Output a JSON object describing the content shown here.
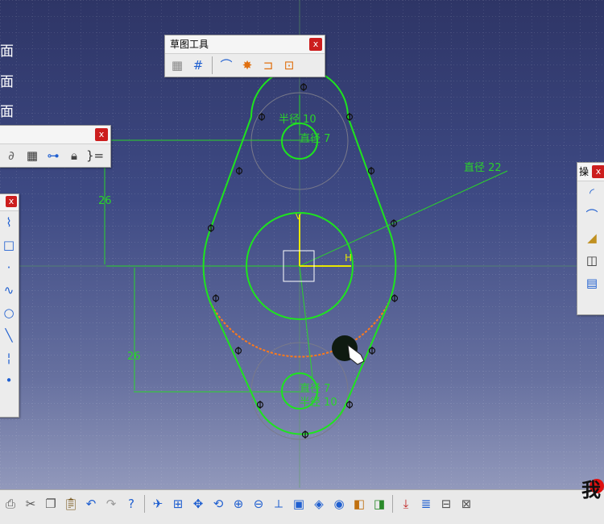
{
  "tree": {
    "items": [
      {
        "label": "面"
      },
      {
        "label": "面"
      },
      {
        "label": "面"
      }
    ]
  },
  "sketch_toolbar": {
    "title": "草图工具",
    "close": "x",
    "icons": [
      "grid-snap-icon",
      "grid-icon",
      "construction-element-icon",
      "geometrical-constraint-icon",
      "dimensional-constraint-icon",
      "auto-constraint-icon"
    ]
  },
  "left_toolbar": {
    "close": "x",
    "icons": [
      "constraint-icon",
      "table-icon",
      "hierarchy-icon",
      "lock-icon",
      "formula-icon"
    ]
  },
  "profile_toolbar": {
    "close": "x",
    "icons": [
      "profile-icon",
      "rectangle-icon",
      "point-icon",
      "spline-icon",
      "circle-icon",
      "line-icon",
      "axis-icon",
      "point-small-icon"
    ]
  },
  "right_toolbar": {
    "title": "操",
    "close": "x",
    "icons": [
      "arc-icon",
      "curve-icon",
      "eraser-icon",
      "mirror-icon",
      "project-icon"
    ]
  },
  "sketch": {
    "dim_radius_top": "半径 10",
    "dim_diameter_top": "直径 7",
    "dim_diameter_large": "直径 22",
    "dim_vertical_top": "26",
    "dim_vertical_bottom": "26",
    "dim_diameter_bottom": "直径 7",
    "dim_radius_bottom": "半径 10",
    "axis_h": "H",
    "axis_v": "V"
  },
  "bottom_toolbar": {
    "icons": [
      "print-icon",
      "cut-icon",
      "copy-icon",
      "paste-icon",
      "undo-icon",
      "redo-icon",
      "whats-this-icon",
      "fly-mode-icon",
      "fit-all-icon",
      "pan-icon",
      "rotate-icon",
      "zoom-in-icon",
      "zoom-out-icon",
      "normal-view-icon",
      "multi-view-icon",
      "iso-view-icon",
      "shading-icon",
      "hide-show-icon",
      "swap-visible-icon",
      "exit-workbench-icon",
      "list-icon",
      "cut-part-icon",
      "drawing-icon"
    ]
  },
  "logo": {
    "text": "我"
  },
  "colors": {
    "sketch_green": "#1ee41e",
    "dim_green": "#2ad42a",
    "constraint_yellow": "#e8e800",
    "orange_highlight": "#ff7a1a",
    "close_red": "#cc1e1e"
  }
}
